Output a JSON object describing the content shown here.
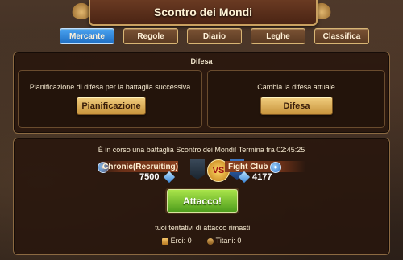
{
  "header": {
    "title": "Scontro dei Mondi"
  },
  "tabs": [
    {
      "label": "Mercante",
      "active": true
    },
    {
      "label": "Regole",
      "active": false
    },
    {
      "label": "Diario",
      "active": false
    },
    {
      "label": "Leghe",
      "active": false
    },
    {
      "label": "Classifica",
      "active": false
    }
  ],
  "defense": {
    "title": "Difesa",
    "left": {
      "text": "Pianificazione di difesa per la battaglia successiva",
      "button": "Pianificazione"
    },
    "right": {
      "text": "Cambia la difesa attuale",
      "button": "Difesa"
    }
  },
  "battle": {
    "status": "È in corso una battaglia Scontro dei Mondi! Termina tra 02:45:25",
    "team_left": {
      "name": "Chronic(Recruiting)",
      "score": "7500"
    },
    "team_right": {
      "name": "Fight Club",
      "score": "4177"
    },
    "vs": "VS",
    "attack_button": "Attacco!",
    "attempts_title": "I tuoi tentativi di attacco rimasti:",
    "heroes": "Eroi: 0",
    "titans": "Titani: 0"
  },
  "colors": {
    "tab_active": "#1f6fc4",
    "tab_inactive": "#5a3a22",
    "gold_button": "#c8943c",
    "attack_button": "#4f9e1d"
  }
}
